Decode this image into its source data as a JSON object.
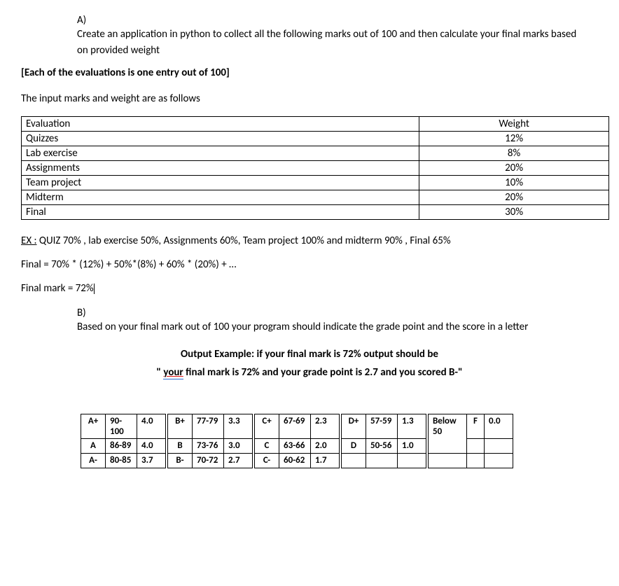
{
  "partA": {
    "label": "A)",
    "text": "Create an application in python to collect all the following marks out of 100 and then calculate your final marks based on provided weight"
  },
  "note": "[Each of the evaluations is one entry out of 100]",
  "intro": "The input marks and weight are as follows",
  "evalTable": {
    "headers": {
      "evaluation": "Evaluation",
      "weight": "Weight"
    },
    "rows": [
      {
        "name": "Quizzes",
        "weight": "12%"
      },
      {
        "name": "Lab exercise",
        "weight": "8%"
      },
      {
        "name": "Assignments",
        "weight": "20%"
      },
      {
        "name": "Team project",
        "weight": "10%"
      },
      {
        "name": "Midterm",
        "weight": "20%"
      },
      {
        "name": "Final",
        "weight": "30%"
      }
    ]
  },
  "example": {
    "label": "EX :",
    "text": " QUIZ 70% , lab exercise 50%, Assignments 60%, Team project 100% and midterm 90% , Final 65%",
    "formula": "Final = 70% * (12%) + 50%*(8%) + 60% * (20%) + …",
    "result": "Final mark  = 72%"
  },
  "partB": {
    "label": "B)",
    "text": "Based on your final mark out of 100 your program should indicate the grade point and the score in a letter"
  },
  "outputExample": {
    "heading": "Output Example: if your final mark is 72% output should be",
    "openQuote": "\" ",
    "your": "your",
    "rest": " final mark is 72% and your grade point is 2.7 and you scored B-\""
  },
  "grades": {
    "rows": [
      [
        {
          "lt": "A+",
          "rg": "90-100",
          "gp": "4.0"
        },
        {
          "lt": "B+",
          "rg": "77-79",
          "gp": "3.3"
        },
        {
          "lt": "C+",
          "rg": "67-69",
          "gp": "2.3"
        },
        {
          "lt": "D+",
          "rg": "57-59",
          "gp": "1.3"
        },
        {
          "lt": "Below 50",
          "rg": "",
          "gp": "",
          "f": "F",
          "fgp": "0.0"
        }
      ],
      [
        {
          "lt": "A",
          "rg": "86-89",
          "gp": "4.0"
        },
        {
          "lt": "B",
          "rg": "73-76",
          "gp": "3.0"
        },
        {
          "lt": "C",
          "rg": "63-66",
          "gp": "2.0"
        },
        {
          "lt": "D",
          "rg": "50-56",
          "gp": "1.0"
        },
        {
          "lt": "",
          "rg": "",
          "gp": "",
          "f": "",
          "fgp": ""
        }
      ],
      [
        {
          "lt": "A-",
          "rg": "80-85",
          "gp": "3.7"
        },
        {
          "lt": "B-",
          "rg": "70-72",
          "gp": "2.7"
        },
        {
          "lt": "C-",
          "rg": "60-62",
          "gp": "1.7"
        },
        {
          "lt": "",
          "rg": "",
          "gp": ""
        },
        {
          "lt": "",
          "rg": "",
          "gp": "",
          "f": "",
          "fgp": ""
        }
      ]
    ]
  }
}
